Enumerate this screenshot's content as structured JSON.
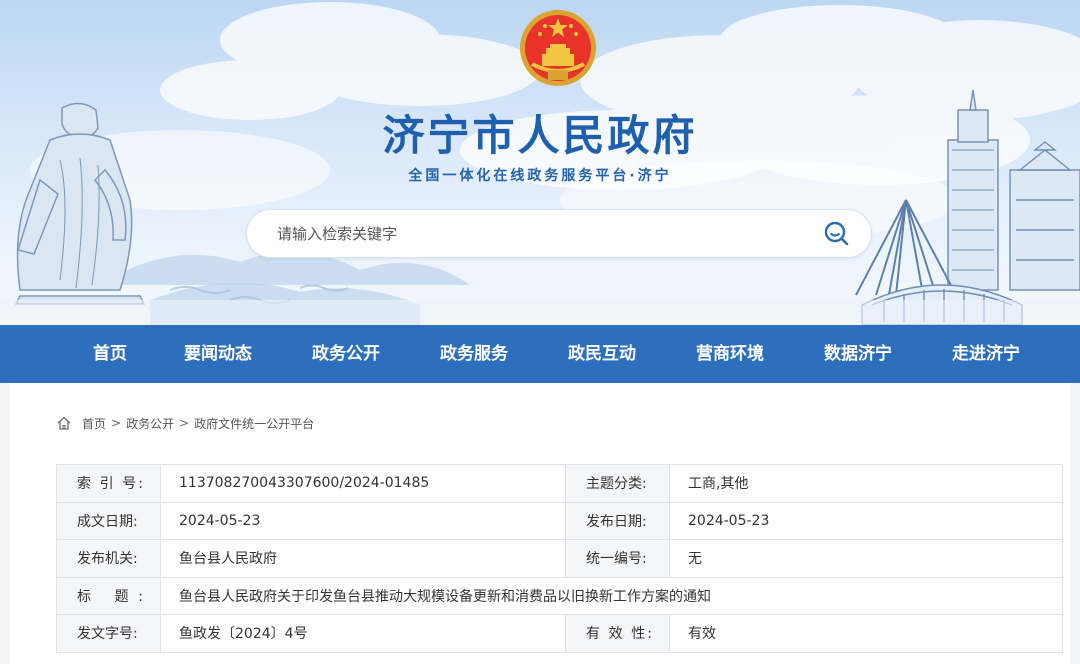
{
  "header": {
    "title": "济宁市人民政府",
    "subtitle": "全国一体化在线政务服务平台·济宁"
  },
  "search": {
    "placeholder": "请输入检索关键字",
    "value": ""
  },
  "nav": {
    "items": [
      "首页",
      "要闻动态",
      "政务公开",
      "政务服务",
      "政民互动",
      "营商环境",
      "数据济宁",
      "走进济宁"
    ]
  },
  "breadcrumb": {
    "items": [
      "首页",
      "政务公开",
      "政府文件统一公开平台"
    ],
    "separator": ">"
  },
  "document_meta": {
    "index_label": "索 引 号:",
    "index_value": "113708270043307600/2024-01485",
    "topic_label": "主题分类:",
    "topic_value": "工商,其他",
    "created_label": "成文日期:",
    "created_value": "2024-05-23",
    "published_label": "发布日期:",
    "published_value": "2024-05-23",
    "issuer_label": "发布机关:",
    "issuer_value": "鱼台县人民政府",
    "serial_label": "统一编号:",
    "serial_value": "无",
    "title_label": "标     题:",
    "title_value": "鱼台县人民政府关于印发鱼台县推动大规模设备更新和消费品以旧换新工作方案的通知",
    "docno_label": "发文字号:",
    "docno_value": "鱼政发〔2024〕4号",
    "validity_label": "有 效 性:",
    "validity_value": "有效"
  },
  "colors": {
    "nav_bg": "#2e6fbd",
    "title_blue": "#1f5fb0",
    "valid_red": "#e2312b",
    "label_bg": "#f5f6f8"
  },
  "icons": {
    "search": "search-icon",
    "home": "home-icon",
    "emblem": "national-emblem-icon"
  }
}
